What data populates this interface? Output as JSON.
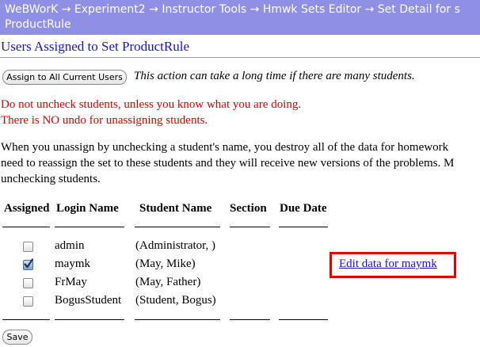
{
  "breadcrumb": {
    "line1": "WeBWorK → Experiment2 → Instructor Tools → Hmwk Sets Editor → Set Detail for s",
    "line2": "ProductRule"
  },
  "page_title": "Users Assigned to Set ProductRule",
  "assign_button": "Assign to All Current Users",
  "assign_note": "This action can take a long time if there are many students.",
  "warnings": [
    "Do not uncheck students, unless you know what you are doing.",
    "There is NO undo for unassigning students."
  ],
  "paragraph": [
    "When you unassign by unchecking a student's name, you destroy all of the data for homework",
    "need to reassign the set to these students and they will receive new versions of the problems. M",
    "unchecking students."
  ],
  "table": {
    "headers": [
      "Assigned",
      "Login Name",
      "Student Name",
      "Section",
      "Due Date"
    ],
    "rows": [
      {
        "assigned": false,
        "login": "admin",
        "name": "(Administrator, )",
        "section": "",
        "due": ""
      },
      {
        "assigned": true,
        "login": "maymk",
        "name": "(May, Mike)",
        "section": "",
        "due": "",
        "edit_link": "Edit data for maymk"
      },
      {
        "assigned": false,
        "login": "FrMay",
        "name": "(May, Father)",
        "section": "",
        "due": ""
      },
      {
        "assigned": false,
        "login": "BogusStudent",
        "name": "(Student, Bogus)",
        "section": "",
        "due": ""
      }
    ]
  },
  "save_button": "Save",
  "colors": {
    "breadcrumb_bg": "#8f8fe6",
    "title": "#1a12d6",
    "warning": "#e00000",
    "link": "#1a12d6",
    "highlight_box": "#e00000"
  }
}
